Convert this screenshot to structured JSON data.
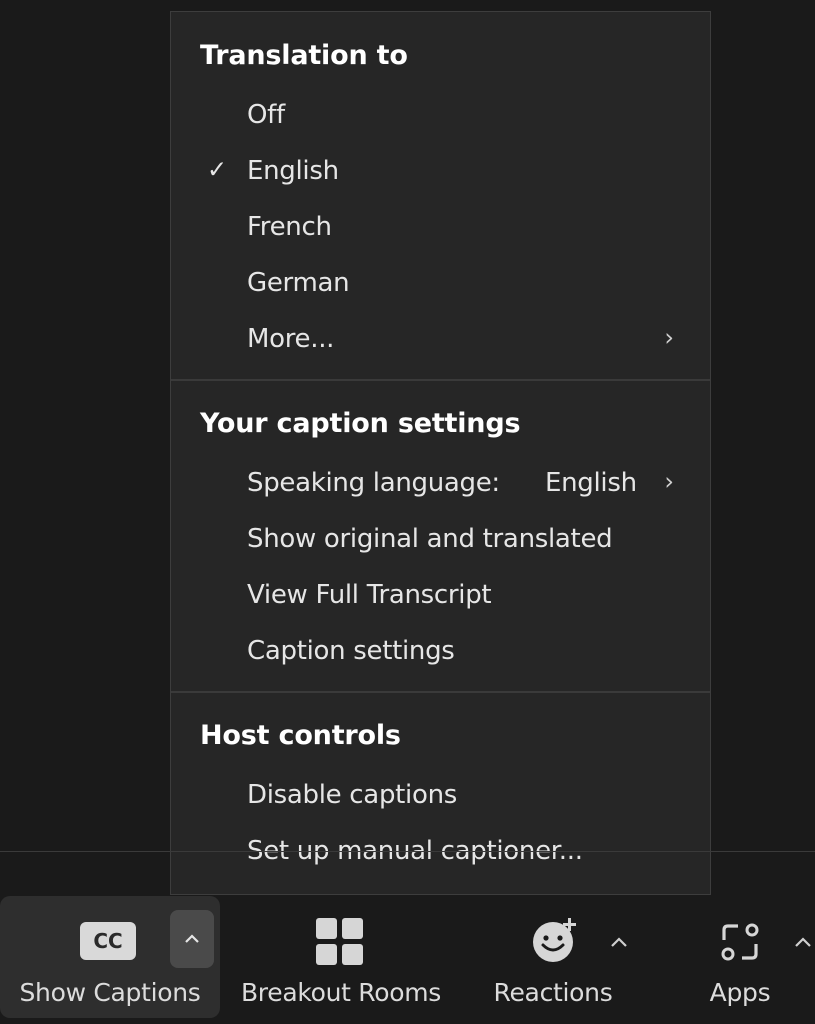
{
  "menu": {
    "translation": {
      "heading": "Translation to",
      "items": [
        {
          "label": "Off",
          "checked": false
        },
        {
          "label": "English",
          "checked": true
        },
        {
          "label": "French",
          "checked": false
        },
        {
          "label": "German",
          "checked": false
        },
        {
          "label": "More...",
          "submenu": true
        }
      ],
      "check_glyph": "✓",
      "chevron_glyph": "›"
    },
    "caption_settings": {
      "heading": "Your caption settings",
      "items": [
        {
          "label": "Speaking language:",
          "value": "English",
          "submenu": true
        },
        {
          "label": "Show original and translated"
        },
        {
          "label": "View Full Transcript"
        },
        {
          "label": "Caption settings"
        }
      ]
    },
    "host_controls": {
      "heading": "Host controls",
      "items": [
        {
          "label": "Disable captions"
        },
        {
          "label": "Set up manual captioner..."
        }
      ]
    }
  },
  "toolbar": {
    "captions": {
      "label": "Show Captions",
      "badge": "CC",
      "caret": "^",
      "icon": "cc-icon"
    },
    "breakout": {
      "label": "Breakout Rooms",
      "icon": "breakout-rooms-icon"
    },
    "reactions": {
      "label": "Reactions",
      "icon": "reactions-icon",
      "caret": "^"
    },
    "apps": {
      "label": "Apps",
      "icon": "apps-icon",
      "caret": "^"
    }
  },
  "colors": {
    "background": "#1a1a1a",
    "menu_bg": "#262626",
    "text": "#e6e6e6",
    "heading": "#ffffff"
  }
}
